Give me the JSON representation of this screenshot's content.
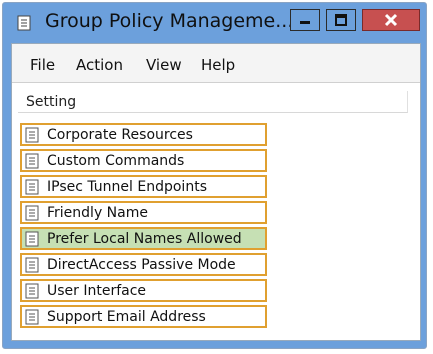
{
  "window": {
    "title": "Group Policy Manageme...",
    "controls": {
      "minimize_icon": "minimize-icon",
      "maximize_icon": "maximize-icon",
      "close_icon": "close-icon"
    }
  },
  "menu": {
    "items": [
      {
        "label": "File"
      },
      {
        "label": "Action"
      },
      {
        "label": "View"
      },
      {
        "label": "Help"
      }
    ]
  },
  "list": {
    "column_header": "Setting",
    "rows": [
      {
        "label": "Corporate Resources",
        "selected": false
      },
      {
        "label": "Custom Commands",
        "selected": false
      },
      {
        "label": "IPsec Tunnel Endpoints",
        "selected": false
      },
      {
        "label": "Friendly Name",
        "selected": false
      },
      {
        "label": "Prefer Local Names Allowed",
        "selected": true
      },
      {
        "label": "DirectAccess Passive Mode",
        "selected": false
      },
      {
        "label": "User Interface",
        "selected": false
      },
      {
        "label": "Support Email Address",
        "selected": false
      }
    ]
  },
  "colors": {
    "title_bar": "#6ca0dc",
    "close_button": "#c75050",
    "row_highlight_border": "#e0a030",
    "selected_row": "#c6e0b4"
  }
}
